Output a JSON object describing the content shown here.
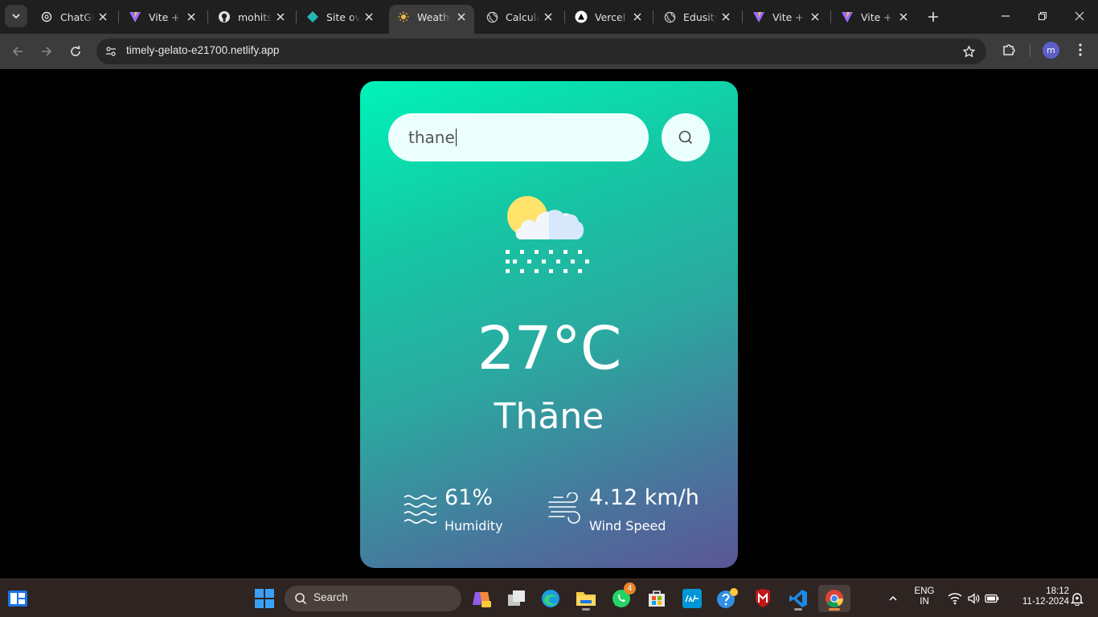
{
  "browser": {
    "tabs": [
      {
        "title": "ChatGPT",
        "icon": "chatgpt-icon"
      },
      {
        "title": "Vite + React",
        "icon": "vite-icon"
      },
      {
        "title": "mohitsk",
        "icon": "github-icon"
      },
      {
        "title": "Site overview",
        "icon": "netlify-icon"
      },
      {
        "title": "Weather App",
        "icon": "sun-icon",
        "active": true
      },
      {
        "title": "Calculator",
        "icon": "globe-icon"
      },
      {
        "title": "Vercel",
        "icon": "vercel-icon"
      },
      {
        "title": "Edusity",
        "icon": "globe-icon"
      },
      {
        "title": "Vite + React",
        "icon": "vite-icon"
      },
      {
        "title": "Vite + React",
        "icon": "vite-icon"
      }
    ],
    "url": "timely-gelato-e21700.netlify.app",
    "profile_initial": "m"
  },
  "weather": {
    "search_value": "thane",
    "condition_icon": "sun-cloud-snow-icon",
    "temperature": "27°C",
    "city": "Thāne",
    "humidity_value": "61%",
    "humidity_label": "Humidity",
    "wind_value": "4.12 km/h",
    "wind_label": "Wind Speed"
  },
  "taskbar": {
    "search_label": "Search",
    "whatsapp_badge": "4",
    "language_top": "ENG",
    "language_bottom": "IN",
    "time": "18:12",
    "date": "11-12-2024"
  },
  "colors": {
    "card_gradient_start": "#00f3b8",
    "card_gradient_end": "#5b5694",
    "tab_bar": "#1f1f1f",
    "toolbar": "#3c3c3c",
    "taskbar": "#2e2421"
  }
}
